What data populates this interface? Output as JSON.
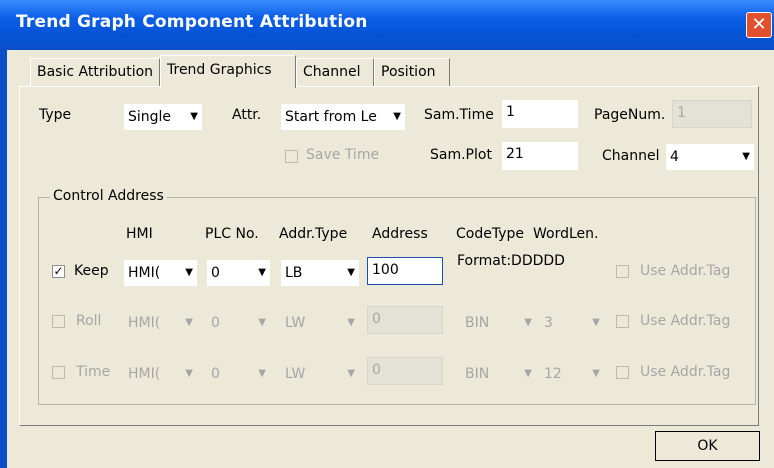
{
  "window": {
    "title": "Trend Graph Component Attribution",
    "close_glyph": "✕"
  },
  "tabs": [
    {
      "label": "Basic Attribution"
    },
    {
      "label": "Trend Graphics"
    },
    {
      "label": "Channel"
    },
    {
      "label": "Position"
    }
  ],
  "top": {
    "type_label": "Type",
    "type_value": "Single",
    "attr_label": "Attr.",
    "attr_value": "Start from Le",
    "samtime_label": "Sam.Time",
    "samtime_value": "1",
    "pagenum_label": "PageNum.",
    "pagenum_value": "1",
    "savetime_label": "Save Time",
    "samplot_label": "Sam.Plot",
    "samplot_value": "21",
    "channel_label": "Channel",
    "channel_value": "4"
  },
  "control": {
    "group_title": "Control Address",
    "headers": {
      "hmi": "HMI",
      "plc": "PLC No.",
      "addrtype": "Addr.Type",
      "address": "Address",
      "codetype": "CodeType",
      "wordlen": "WordLen."
    },
    "format_text": "Format:DDDDD",
    "rows": [
      {
        "label": "Keep",
        "checked": "✓",
        "hmi": "HMI(",
        "plc": "0",
        "addrtype": "LB",
        "address": "100",
        "use_tag": "Use Addr.Tag"
      },
      {
        "label": "Roll",
        "hmi": "HMI(",
        "plc": "0",
        "addrtype": "LW",
        "address": "0",
        "codetype": "BIN",
        "wordlen": "3",
        "use_tag": "Use Addr.Tag"
      },
      {
        "label": "Time",
        "hmi": "HMI(",
        "plc": "0",
        "addrtype": "LW",
        "address": "0",
        "codetype": "BIN",
        "wordlen": "12",
        "use_tag": "Use Addr.Tag"
      }
    ]
  },
  "buttons": {
    "ok": "OK"
  },
  "icons": {
    "dropdown": "chevron-down-icon",
    "check": "checkmark-icon",
    "close": "close-icon"
  },
  "colors": {
    "titlebar": "#0a5fe6",
    "close": "#e2512e",
    "dialog_bg": "#ece9d8"
  }
}
